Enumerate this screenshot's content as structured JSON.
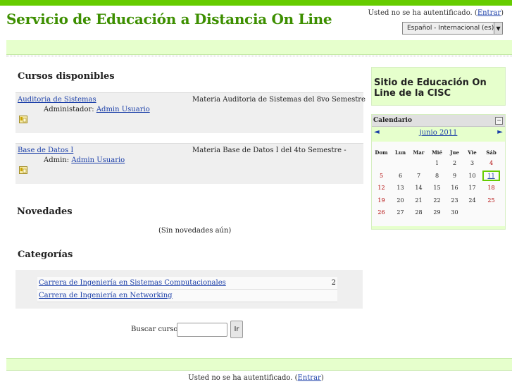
{
  "header": {
    "site_title": "Servicio de Educación a Distancia On Line",
    "login_info_prefix": "Usted no se ha autentificado. (",
    "login_link": "Entrar",
    "login_info_suffix": ")",
    "language": "Español - Internacional (es)"
  },
  "available_courses": {
    "title": "Cursos disponibles",
    "courses": [
      {
        "name": "Auditoria de Sistemas",
        "teacher_role": "Administador:",
        "teacher_name": "Admin Usuario",
        "summary": "Materia Auditoria de Sistemas del 8vo Semestre"
      },
      {
        "name": "Base de Datos I",
        "teacher_role": "Admin:",
        "teacher_name": "Admin Usuario",
        "summary": "Materia Base de Datos I del 4to Semestre -"
      }
    ]
  },
  "news": {
    "title": "Novedades",
    "empty": "(Sin novedades aún)"
  },
  "categories": {
    "title": "Categorías",
    "items": [
      {
        "name": "Carrera de Ingeniería en Sistemas Computacionales",
        "count": "2"
      },
      {
        "name": "Carrera de Ingeniería en Networking",
        "count": ""
      }
    ]
  },
  "search": {
    "label": "Buscar cursos:",
    "button": "Ir",
    "value": ""
  },
  "sidebar": {
    "site_block_title": "Sitio de Educación On Line de la CISC",
    "calendar": {
      "title": "Calendario",
      "hide_icon": "−",
      "prev": "◄",
      "month": "junio 2011",
      "next": "►",
      "weekdays": [
        "Dom",
        "Lun",
        "Mar",
        "Mié",
        "Jue",
        "Vie",
        "Sáb"
      ],
      "weeks": [
        [
          "",
          "",
          "",
          "1",
          "2",
          "3",
          "4"
        ],
        [
          "5",
          "6",
          "7",
          "8",
          "9",
          "10",
          "11"
        ],
        [
          "12",
          "13",
          "14",
          "15",
          "16",
          "17",
          "18"
        ],
        [
          "19",
          "20",
          "21",
          "22",
          "23",
          "24",
          "25"
        ],
        [
          "26",
          "27",
          "28",
          "29",
          "30",
          "",
          ""
        ]
      ],
      "today": "11"
    }
  },
  "footer": {
    "login_info_prefix": "Usted no se ha autentificado. (",
    "login_link": "Entrar",
    "login_info_suffix": ")"
  }
}
